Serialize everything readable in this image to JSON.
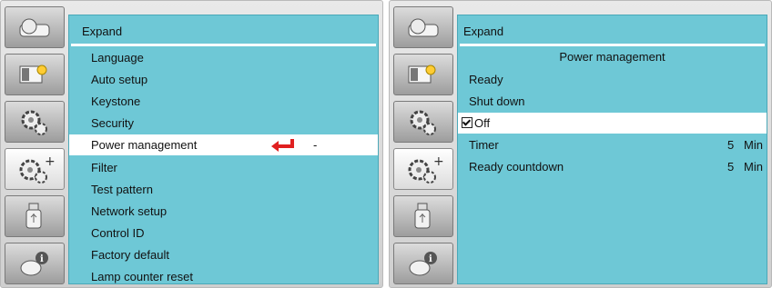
{
  "left_panel": {
    "title": "Expand",
    "items": [
      {
        "label": "Language"
      },
      {
        "label": "Auto setup"
      },
      {
        "label": "Keystone"
      },
      {
        "label": "Security"
      },
      {
        "label": "Power management",
        "selected": true,
        "mark": "-"
      },
      {
        "label": "Filter"
      },
      {
        "label": "Test pattern"
      },
      {
        "label": "Network setup"
      },
      {
        "label": "Control ID"
      },
      {
        "label": "Factory default"
      },
      {
        "label": "Lamp counter reset"
      }
    ],
    "enter_icon_color": "#e02020"
  },
  "right_panel": {
    "title": "Expand",
    "subtitle": "Power management",
    "items": [
      {
        "label": "Ready"
      },
      {
        "label": "Shut down"
      },
      {
        "label": "Off",
        "checked": true,
        "selected": true
      },
      {
        "label": "Timer",
        "value": "5",
        "unit": "Min"
      },
      {
        "label": "Ready countdown",
        "value": "5",
        "unit": "Min"
      }
    ]
  },
  "sidebar_tabs": [
    {
      "icon": "projector-icon"
    },
    {
      "icon": "image-adjust-icon"
    },
    {
      "icon": "setup-gear-icon"
    },
    {
      "icon": "expand-gear-plus-icon",
      "active": true
    },
    {
      "icon": "usb-drive-icon"
    },
    {
      "icon": "information-icon"
    }
  ],
  "colors": {
    "content_bg": "#6ec8d6",
    "selected_row_bg": "#ffffff",
    "active_tab_bg": "#ffffff"
  }
}
